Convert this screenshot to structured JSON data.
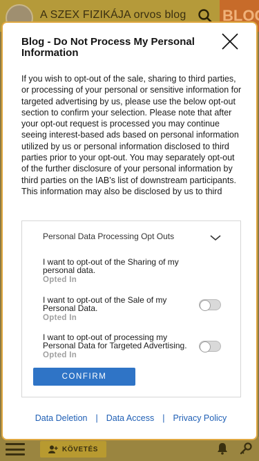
{
  "site": {
    "title": "A SZEX FIZIKÁJA orvos blog",
    "logo_text": "BLOG",
    "follow_label": "KÖVETÉS"
  },
  "modal": {
    "title": "Blog - Do Not Process My Personal Information",
    "description": "If you wish to opt-out of the sale, sharing to third parties, or processing of your personal or sensitive information for targeted advertising by us, please use the below opt-out section to confirm your selection. Please note that after your opt-out request is processed you may continue seeing interest-based ads based on personal information utilized by us or personal information disclosed to third parties prior to your opt-out. You may separately opt-out of the further disclosure of your personal information by third parties on the IAB’s list of downstream participants. This information may also be disclosed by us to third",
    "section_title": "Personal Data Processing Opt Outs",
    "options": [
      {
        "label": "I want to opt-out of the Sharing of my personal data.",
        "status": "Opted In"
      },
      {
        "label": "I want to opt-out of the Sale of my Personal Data.",
        "status": "Opted In"
      },
      {
        "label": "I want to opt-out of processing my Personal Data for Targeted Advertising.",
        "status": "Opted In"
      }
    ],
    "confirm_label": "CONFIRM",
    "links": {
      "data_deletion": "Data Deletion",
      "data_access": "Data Access",
      "privacy_policy": "Privacy Policy",
      "separator": "|"
    }
  },
  "colors": {
    "accent": "#2f74c6",
    "link": "#1f5fb5",
    "modal_border": "#e0a840",
    "status_text": "#a0a0a0"
  },
  "icons": [
    "search-icon",
    "close-icon",
    "chevron-down-icon",
    "menu-icon",
    "user-add-icon",
    "bell-icon",
    "key-icon"
  ]
}
